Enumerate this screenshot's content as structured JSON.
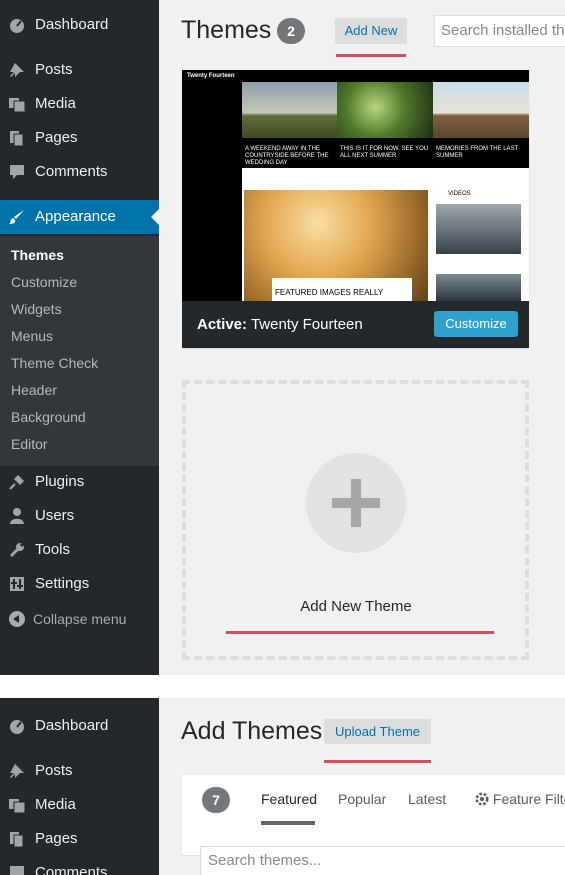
{
  "sidebar": {
    "items": [
      {
        "label": "Dashboard",
        "icon": "dashboard-icon"
      },
      {
        "label": "Posts",
        "icon": "pin-icon"
      },
      {
        "label": "Media",
        "icon": "media-icon"
      },
      {
        "label": "Pages",
        "icon": "pages-icon"
      },
      {
        "label": "Comments",
        "icon": "comment-icon"
      },
      {
        "label": "Appearance",
        "icon": "brush-icon"
      },
      {
        "label": "Plugins",
        "icon": "plug-icon"
      },
      {
        "label": "Users",
        "icon": "user-icon"
      },
      {
        "label": "Tools",
        "icon": "wrench-icon"
      },
      {
        "label": "Settings",
        "icon": "settings-icon"
      }
    ],
    "submenu": [
      "Themes",
      "Customize",
      "Widgets",
      "Menus",
      "Theme Check",
      "Header",
      "Background",
      "Editor"
    ],
    "collapse_label": "Collapse menu"
  },
  "themes_page": {
    "title": "Themes",
    "count": "2",
    "add_new_label": "Add New",
    "search_placeholder": "Search installed themes...",
    "active_theme": {
      "active_prefix": "Active:",
      "name": "Twenty Fourteen",
      "customize_label": "Customize"
    },
    "screenshot_text": {
      "site_title": "Twenty Fourteen",
      "caption_1": "A WEEKEND AWAY IN THE COUNTRYSIDE BEFORE THE WEDDING DAY",
      "caption_2": "THIS IS IT FOR NOW. SEE YOU ALL NEXT SUMMER",
      "caption_3": "MEMORIES FROM THE LAST SUMMER",
      "featured": "FEATURED IMAGES REALLY",
      "video_label": "VIDEOS"
    },
    "add_new_theme_label": "Add New Theme"
  },
  "add_themes_page": {
    "title": "Add Themes",
    "upload_label": "Upload Theme",
    "count": "7",
    "tabs": [
      "Featured",
      "Popular",
      "Latest",
      "Feature Filter"
    ],
    "search_placeholder": "Search themes..."
  },
  "colors": {
    "sidebar_bg": "#23282d",
    "accent": "#0073aa",
    "highlight_line": "#d54e5e"
  }
}
